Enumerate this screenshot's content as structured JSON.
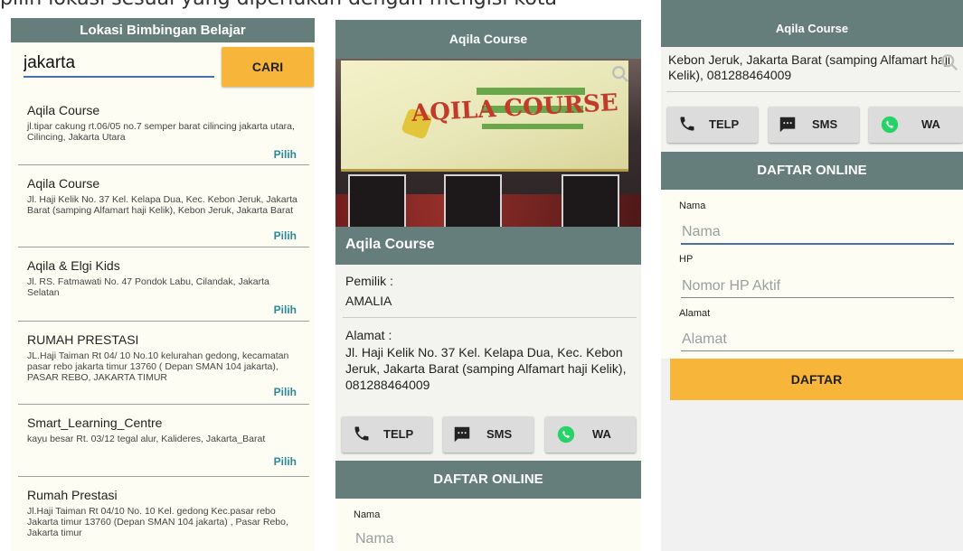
{
  "top_caption": "pilih lokasi sesuai yang diperlukan dengan mengisi kota",
  "screen1": {
    "title": "Lokasi Bimbingan Belajar",
    "search_value": "jakarta",
    "search_button": "CARI",
    "pilih_label": "Pilih",
    "results": [
      {
        "name": "Aqila Course",
        "address": "jl.tipar cakung rt.06/05 no.7 semper barat cilincing jakarta utara, Cilincing, Jakarta Utara"
      },
      {
        "name": "Aqila Course",
        "address": "Jl. Haji Kelik No. 37 Kel. Kelapa Dua, Kec. Kebon Jeruk, Jakarta Barat (samping Alfamart haji Kelik), Kebon Jeruk, Jakarta Barat"
      },
      {
        "name": "Aqila & Elgi Kids",
        "address": "Jl. RS. Fatmawati No. 47 Pondok Labu, Cilandak, Jakarta Selatan"
      },
      {
        "name": "RUMAH PRESTASI",
        "address": "JL.Haji Taiman Rt 04/ 10 No.10 kelurahan gedong, kecamatan pasar rebo jakarta timur 13760 ( Depan SMAN 104 jakarta), PASAR REBO, JAKARTA TIMUR"
      },
      {
        "name": "Smart_Learning_Centre",
        "address": "kayu besar Rt. 03/12 tegal alur, Kalideres, Jakarta_Barat"
      },
      {
        "name": "Rumah Prestasi",
        "address": "Jl.Haji Taiman Rt 04/10 No. 10 Kel. gedong Kec.pasar rebo Jakarta timur 13760 (Depan SMAN 104 jakarta) , Pasar Rebo, Jakarta timur"
      }
    ]
  },
  "screen2": {
    "title": "Aqila Course",
    "banner_text": "AQILA COURSE",
    "course_name": "Aqila Course",
    "owner_label": "Pemilik :",
    "owner_value": "AMALIA",
    "address_label": "Alamat :",
    "address_value": "Jl. Haji Kelik No. 37 Kel. Kelapa Dua, Kec. Kebon Jeruk, Jakarta Barat (samping Alfamart haji Kelik), 081288464009",
    "buttons": {
      "telp": "TELP",
      "sms": "SMS",
      "wa": "WA"
    },
    "daftar_header": "DAFTAR ONLINE",
    "nama_label": "Nama",
    "nama_placeholder": "Nama"
  },
  "screen3": {
    "title": "Aqila Course",
    "address_visible": "Kebon Jeruk, Jakarta Barat (samping Alfamart haji Kelik), 081288464009",
    "buttons": {
      "telp": "TELP",
      "sms": "SMS",
      "wa": "WA"
    },
    "daftar_header": "DAFTAR ONLINE",
    "fields": {
      "nama_label": "Nama",
      "nama_placeholder": "Nama",
      "hp_label": "HP",
      "hp_placeholder": "Nomor HP Aktif",
      "alamat_label": "Alamat",
      "alamat_placeholder": "Alamat"
    },
    "submit": "DAFTAR"
  },
  "colors": {
    "appbar": "#667e7b",
    "accent": "#f7b53a",
    "link": "#2a8a99",
    "wa_green": "#25d366"
  }
}
